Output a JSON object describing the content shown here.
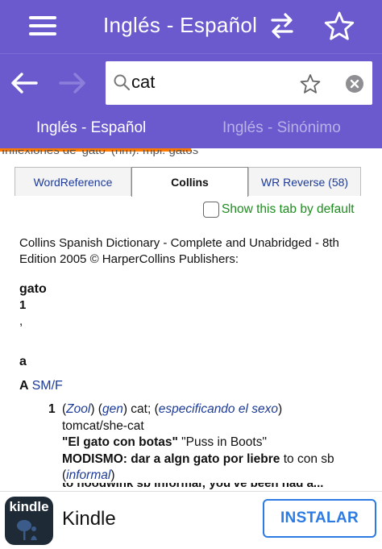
{
  "header": {
    "title": "Inglés - Español",
    "menu_icon": "hamburger-icon",
    "swap_icon": "swap-arrows-icon",
    "favorite_icon": "star-outline-icon"
  },
  "search": {
    "value": "cat",
    "placeholder": "",
    "back_icon": "back-arrow-icon",
    "forward_icon": "forward-arrow-icon",
    "search_icon": "search-icon",
    "star_icon": "star-outline-icon",
    "clear_icon": "clear-icon"
  },
  "lang_tabs": [
    {
      "label": "Inglés - Español",
      "active": true
    },
    {
      "label": "Inglés - Sinónimo",
      "active": false
    }
  ],
  "load_progress": 0.5,
  "peek_text": "Inflexiones de 'gato' (nm): mpl: gatos",
  "dict_tabs": [
    {
      "label": "WordReference"
    },
    {
      "label": "Collins",
      "active": true
    },
    {
      "label": "WR Reverse (58)"
    }
  ],
  "default_option": {
    "label": "Show this tab by default",
    "checked": false
  },
  "entry": {
    "credit": "Collins Spanish Dictionary - Complete and Unabridged - 8th Edition 2005 © HarperCollins Publishers:",
    "headword": "gato",
    "sense_no": "1",
    "comma": ",",
    "letter": "a",
    "gram_letter": "A",
    "gram": "SM/F",
    "sense": {
      "num": "1",
      "p1": "(",
      "zool": "Zool",
      "p2": ") (",
      "gen": "gen",
      "p3": ") cat; (",
      "spec": "especificando el sexo",
      "p4": ")",
      "line2": "tomcat/she-cat",
      "ex_es": "\"El gato con botas\"",
      "ex_en": " \"Puss in Boots\"",
      "idiom_label": "MODISMO: dar a algn gato por liebre",
      "idiom_en": " to con sb",
      "informal_open": "(",
      "informal": "informal",
      "informal_close": ")",
      "cutoff": "to hoodwink sb informal; you've been had a..."
    }
  },
  "ad": {
    "brand_logo_text": "kindle",
    "app_name": "Kindle",
    "install_label": "INSTALAR"
  },
  "colors": {
    "primary": "#6a5acd",
    "progress": "#ff7a00",
    "link": "#1b3a99",
    "green": "#1e8c1e",
    "install": "#2c7be5"
  }
}
